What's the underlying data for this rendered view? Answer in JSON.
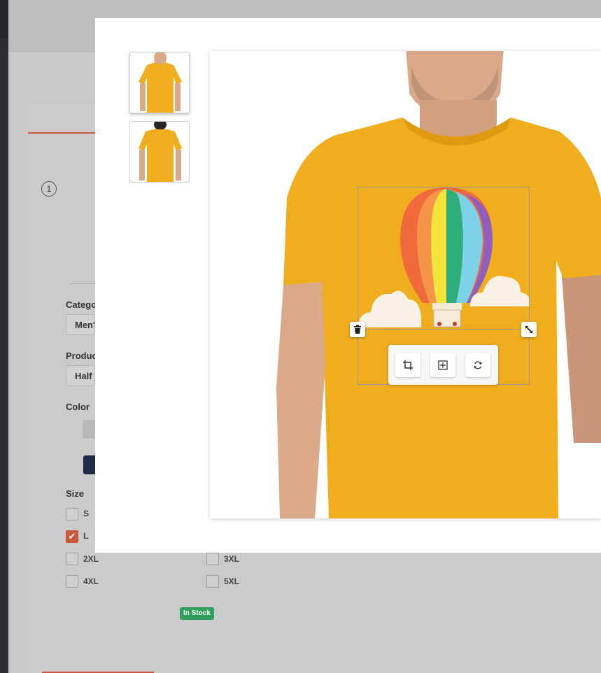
{
  "background_form": {
    "step_number": "1",
    "category": {
      "label": "Categor",
      "value": "Men'"
    },
    "product": {
      "label": "Product",
      "value": "Half S"
    },
    "color": {
      "label": "Color"
    },
    "size": {
      "label": "Size",
      "options": [
        {
          "label": "S",
          "checked": false
        },
        {
          "label": "L",
          "checked": true
        },
        {
          "label": "2XL",
          "checked": false
        },
        {
          "label": "3XL",
          "checked": false
        },
        {
          "label": "4XL",
          "checked": false
        },
        {
          "label": "5XL",
          "checked": false
        }
      ]
    },
    "stock_badge": "In Stock"
  },
  "modal": {
    "thumbnails": [
      {
        "name": "front-view"
      },
      {
        "name": "back-view"
      }
    ],
    "design_toolbar": {
      "tools": [
        "crop-icon",
        "align-center-icon",
        "rotate-icon"
      ]
    },
    "handles": [
      "trash-icon",
      "resize-icon"
    ]
  },
  "colors": {
    "shirt": "#f0ad1e",
    "accent": "#c8583f",
    "in_stock": "#2f9e5a",
    "balloon_stripes": [
      "#f06a3c",
      "#f6954a",
      "#f7e43a",
      "#2fae7c",
      "#7dd2e8",
      "#8f5fbf"
    ]
  }
}
